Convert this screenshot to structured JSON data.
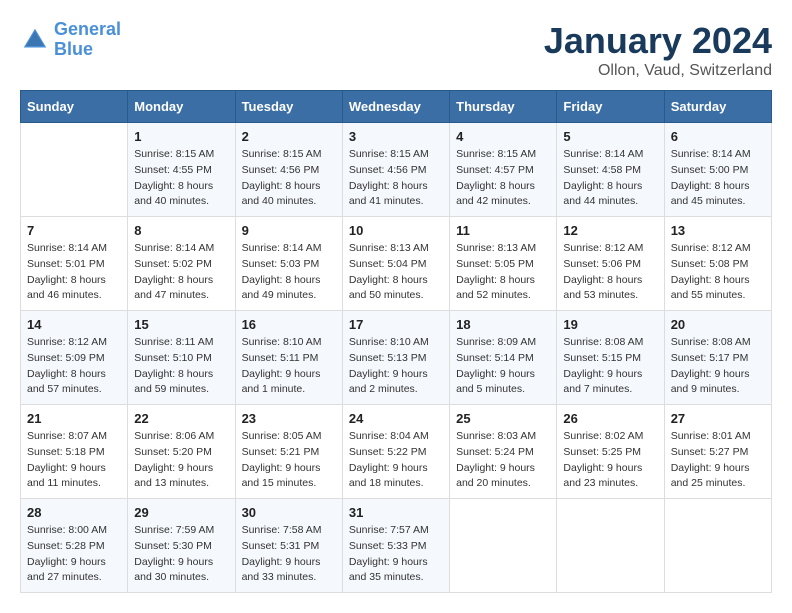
{
  "header": {
    "logo_line1": "General",
    "logo_line2": "Blue",
    "month": "January 2024",
    "location": "Ollon, Vaud, Switzerland"
  },
  "weekdays": [
    "Sunday",
    "Monday",
    "Tuesday",
    "Wednesday",
    "Thursday",
    "Friday",
    "Saturday"
  ],
  "weeks": [
    [
      {
        "day": "",
        "sunrise": "",
        "sunset": "",
        "daylight": ""
      },
      {
        "day": "1",
        "sunrise": "Sunrise: 8:15 AM",
        "sunset": "Sunset: 4:55 PM",
        "daylight": "Daylight: 8 hours and 40 minutes."
      },
      {
        "day": "2",
        "sunrise": "Sunrise: 8:15 AM",
        "sunset": "Sunset: 4:56 PM",
        "daylight": "Daylight: 8 hours and 40 minutes."
      },
      {
        "day": "3",
        "sunrise": "Sunrise: 8:15 AM",
        "sunset": "Sunset: 4:56 PM",
        "daylight": "Daylight: 8 hours and 41 minutes."
      },
      {
        "day": "4",
        "sunrise": "Sunrise: 8:15 AM",
        "sunset": "Sunset: 4:57 PM",
        "daylight": "Daylight: 8 hours and 42 minutes."
      },
      {
        "day": "5",
        "sunrise": "Sunrise: 8:14 AM",
        "sunset": "Sunset: 4:58 PM",
        "daylight": "Daylight: 8 hours and 44 minutes."
      },
      {
        "day": "6",
        "sunrise": "Sunrise: 8:14 AM",
        "sunset": "Sunset: 5:00 PM",
        "daylight": "Daylight: 8 hours and 45 minutes."
      }
    ],
    [
      {
        "day": "7",
        "sunrise": "Sunrise: 8:14 AM",
        "sunset": "Sunset: 5:01 PM",
        "daylight": "Daylight: 8 hours and 46 minutes."
      },
      {
        "day": "8",
        "sunrise": "Sunrise: 8:14 AM",
        "sunset": "Sunset: 5:02 PM",
        "daylight": "Daylight: 8 hours and 47 minutes."
      },
      {
        "day": "9",
        "sunrise": "Sunrise: 8:14 AM",
        "sunset": "Sunset: 5:03 PM",
        "daylight": "Daylight: 8 hours and 49 minutes."
      },
      {
        "day": "10",
        "sunrise": "Sunrise: 8:13 AM",
        "sunset": "Sunset: 5:04 PM",
        "daylight": "Daylight: 8 hours and 50 minutes."
      },
      {
        "day": "11",
        "sunrise": "Sunrise: 8:13 AM",
        "sunset": "Sunset: 5:05 PM",
        "daylight": "Daylight: 8 hours and 52 minutes."
      },
      {
        "day": "12",
        "sunrise": "Sunrise: 8:12 AM",
        "sunset": "Sunset: 5:06 PM",
        "daylight": "Daylight: 8 hours and 53 minutes."
      },
      {
        "day": "13",
        "sunrise": "Sunrise: 8:12 AM",
        "sunset": "Sunset: 5:08 PM",
        "daylight": "Daylight: 8 hours and 55 minutes."
      }
    ],
    [
      {
        "day": "14",
        "sunrise": "Sunrise: 8:12 AM",
        "sunset": "Sunset: 5:09 PM",
        "daylight": "Daylight: 8 hours and 57 minutes."
      },
      {
        "day": "15",
        "sunrise": "Sunrise: 8:11 AM",
        "sunset": "Sunset: 5:10 PM",
        "daylight": "Daylight: 8 hours and 59 minutes."
      },
      {
        "day": "16",
        "sunrise": "Sunrise: 8:10 AM",
        "sunset": "Sunset: 5:11 PM",
        "daylight": "Daylight: 9 hours and 1 minute."
      },
      {
        "day": "17",
        "sunrise": "Sunrise: 8:10 AM",
        "sunset": "Sunset: 5:13 PM",
        "daylight": "Daylight: 9 hours and 2 minutes."
      },
      {
        "day": "18",
        "sunrise": "Sunrise: 8:09 AM",
        "sunset": "Sunset: 5:14 PM",
        "daylight": "Daylight: 9 hours and 5 minutes."
      },
      {
        "day": "19",
        "sunrise": "Sunrise: 8:08 AM",
        "sunset": "Sunset: 5:15 PM",
        "daylight": "Daylight: 9 hours and 7 minutes."
      },
      {
        "day": "20",
        "sunrise": "Sunrise: 8:08 AM",
        "sunset": "Sunset: 5:17 PM",
        "daylight": "Daylight: 9 hours and 9 minutes."
      }
    ],
    [
      {
        "day": "21",
        "sunrise": "Sunrise: 8:07 AM",
        "sunset": "Sunset: 5:18 PM",
        "daylight": "Daylight: 9 hours and 11 minutes."
      },
      {
        "day": "22",
        "sunrise": "Sunrise: 8:06 AM",
        "sunset": "Sunset: 5:20 PM",
        "daylight": "Daylight: 9 hours and 13 minutes."
      },
      {
        "day": "23",
        "sunrise": "Sunrise: 8:05 AM",
        "sunset": "Sunset: 5:21 PM",
        "daylight": "Daylight: 9 hours and 15 minutes."
      },
      {
        "day": "24",
        "sunrise": "Sunrise: 8:04 AM",
        "sunset": "Sunset: 5:22 PM",
        "daylight": "Daylight: 9 hours and 18 minutes."
      },
      {
        "day": "25",
        "sunrise": "Sunrise: 8:03 AM",
        "sunset": "Sunset: 5:24 PM",
        "daylight": "Daylight: 9 hours and 20 minutes."
      },
      {
        "day": "26",
        "sunrise": "Sunrise: 8:02 AM",
        "sunset": "Sunset: 5:25 PM",
        "daylight": "Daylight: 9 hours and 23 minutes."
      },
      {
        "day": "27",
        "sunrise": "Sunrise: 8:01 AM",
        "sunset": "Sunset: 5:27 PM",
        "daylight": "Daylight: 9 hours and 25 minutes."
      }
    ],
    [
      {
        "day": "28",
        "sunrise": "Sunrise: 8:00 AM",
        "sunset": "Sunset: 5:28 PM",
        "daylight": "Daylight: 9 hours and 27 minutes."
      },
      {
        "day": "29",
        "sunrise": "Sunrise: 7:59 AM",
        "sunset": "Sunset: 5:30 PM",
        "daylight": "Daylight: 9 hours and 30 minutes."
      },
      {
        "day": "30",
        "sunrise": "Sunrise: 7:58 AM",
        "sunset": "Sunset: 5:31 PM",
        "daylight": "Daylight: 9 hours and 33 minutes."
      },
      {
        "day": "31",
        "sunrise": "Sunrise: 7:57 AM",
        "sunset": "Sunset: 5:33 PM",
        "daylight": "Daylight: 9 hours and 35 minutes."
      },
      {
        "day": "",
        "sunrise": "",
        "sunset": "",
        "daylight": ""
      },
      {
        "day": "",
        "sunrise": "",
        "sunset": "",
        "daylight": ""
      },
      {
        "day": "",
        "sunrise": "",
        "sunset": "",
        "daylight": ""
      }
    ]
  ]
}
